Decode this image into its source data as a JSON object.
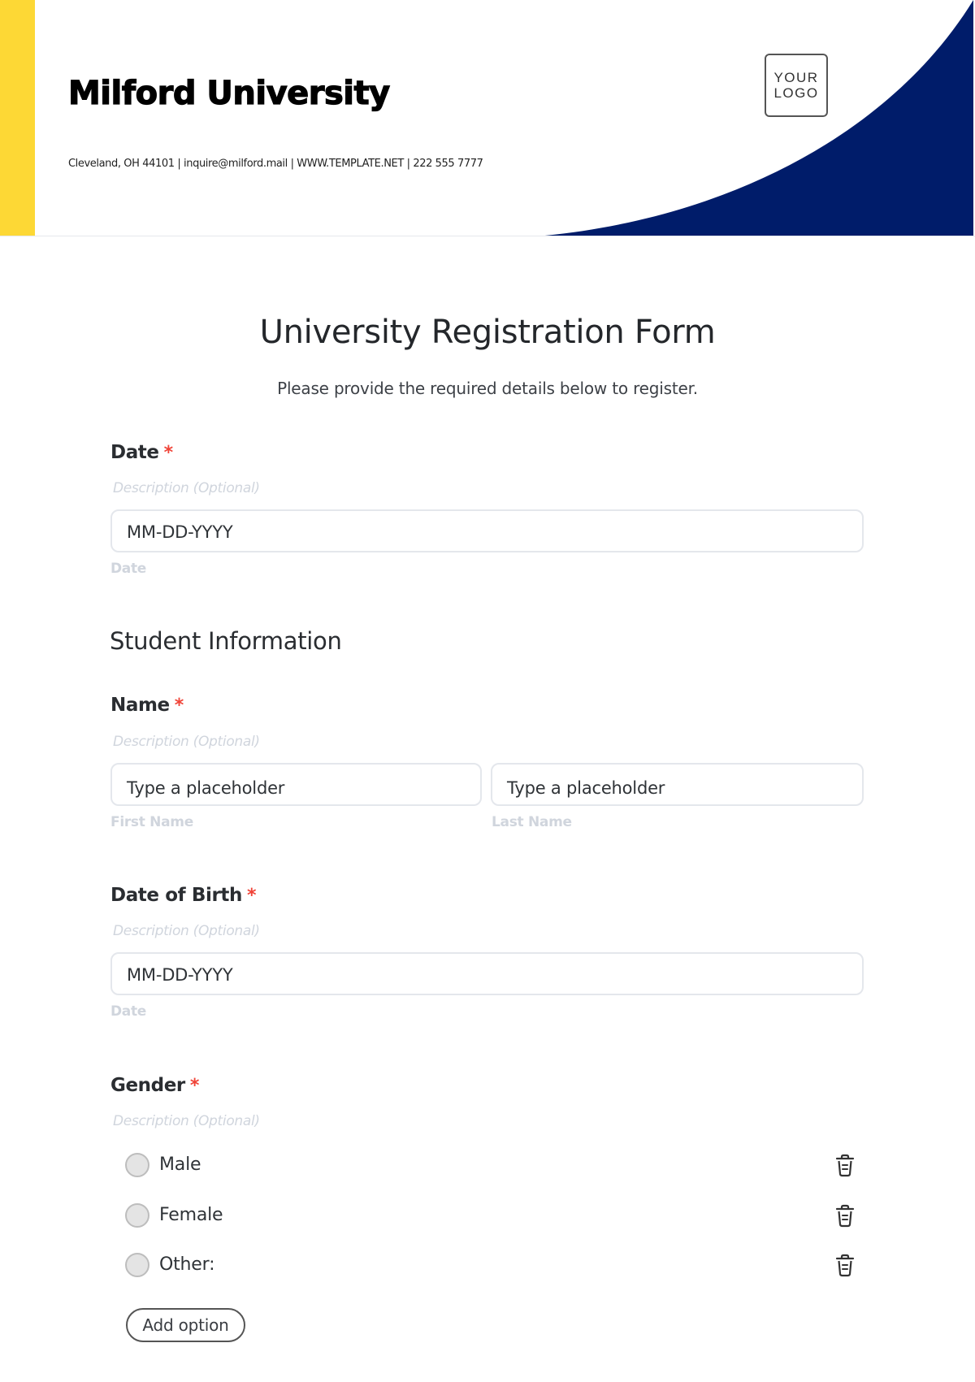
{
  "header": {
    "university_name": "Milford University",
    "contact_line": "Cleveland, OH 44101 | inquire@milford.mail | WWW.TEMPLATE.NET | 222 555 7777",
    "logo_line1": "YOUR",
    "logo_line2": "LOGO",
    "colors": {
      "accent": "#fdd835",
      "navy": "#001c6a"
    }
  },
  "form": {
    "title": "University Registration Form",
    "subtitle": "Please provide the required details below to register.",
    "required_marker": "*",
    "fields": {
      "date": {
        "label": "Date",
        "description": "Description (Optional)",
        "value": "MM-DD-YYYY",
        "sublabel": "Date"
      },
      "section_student": "Student Information",
      "name": {
        "label": "Name",
        "description": "Description (Optional)",
        "first_placeholder": "Type a placeholder",
        "first_sublabel": "First Name",
        "last_placeholder": "Type a placeholder",
        "last_sublabel": "Last Name"
      },
      "dob": {
        "label": "Date of Birth",
        "description": "Description (Optional)",
        "value": "MM-DD-YYYY",
        "sublabel": "Date"
      },
      "gender": {
        "label": "Gender",
        "description": "Description (Optional)",
        "options": [
          {
            "label": "Male",
            "selected": false
          },
          {
            "label": "Female",
            "selected": false
          },
          {
            "label": "Other:",
            "selected": false
          }
        ],
        "delete_icon": "trash-icon",
        "add_option_label": "Add option"
      }
    }
  }
}
